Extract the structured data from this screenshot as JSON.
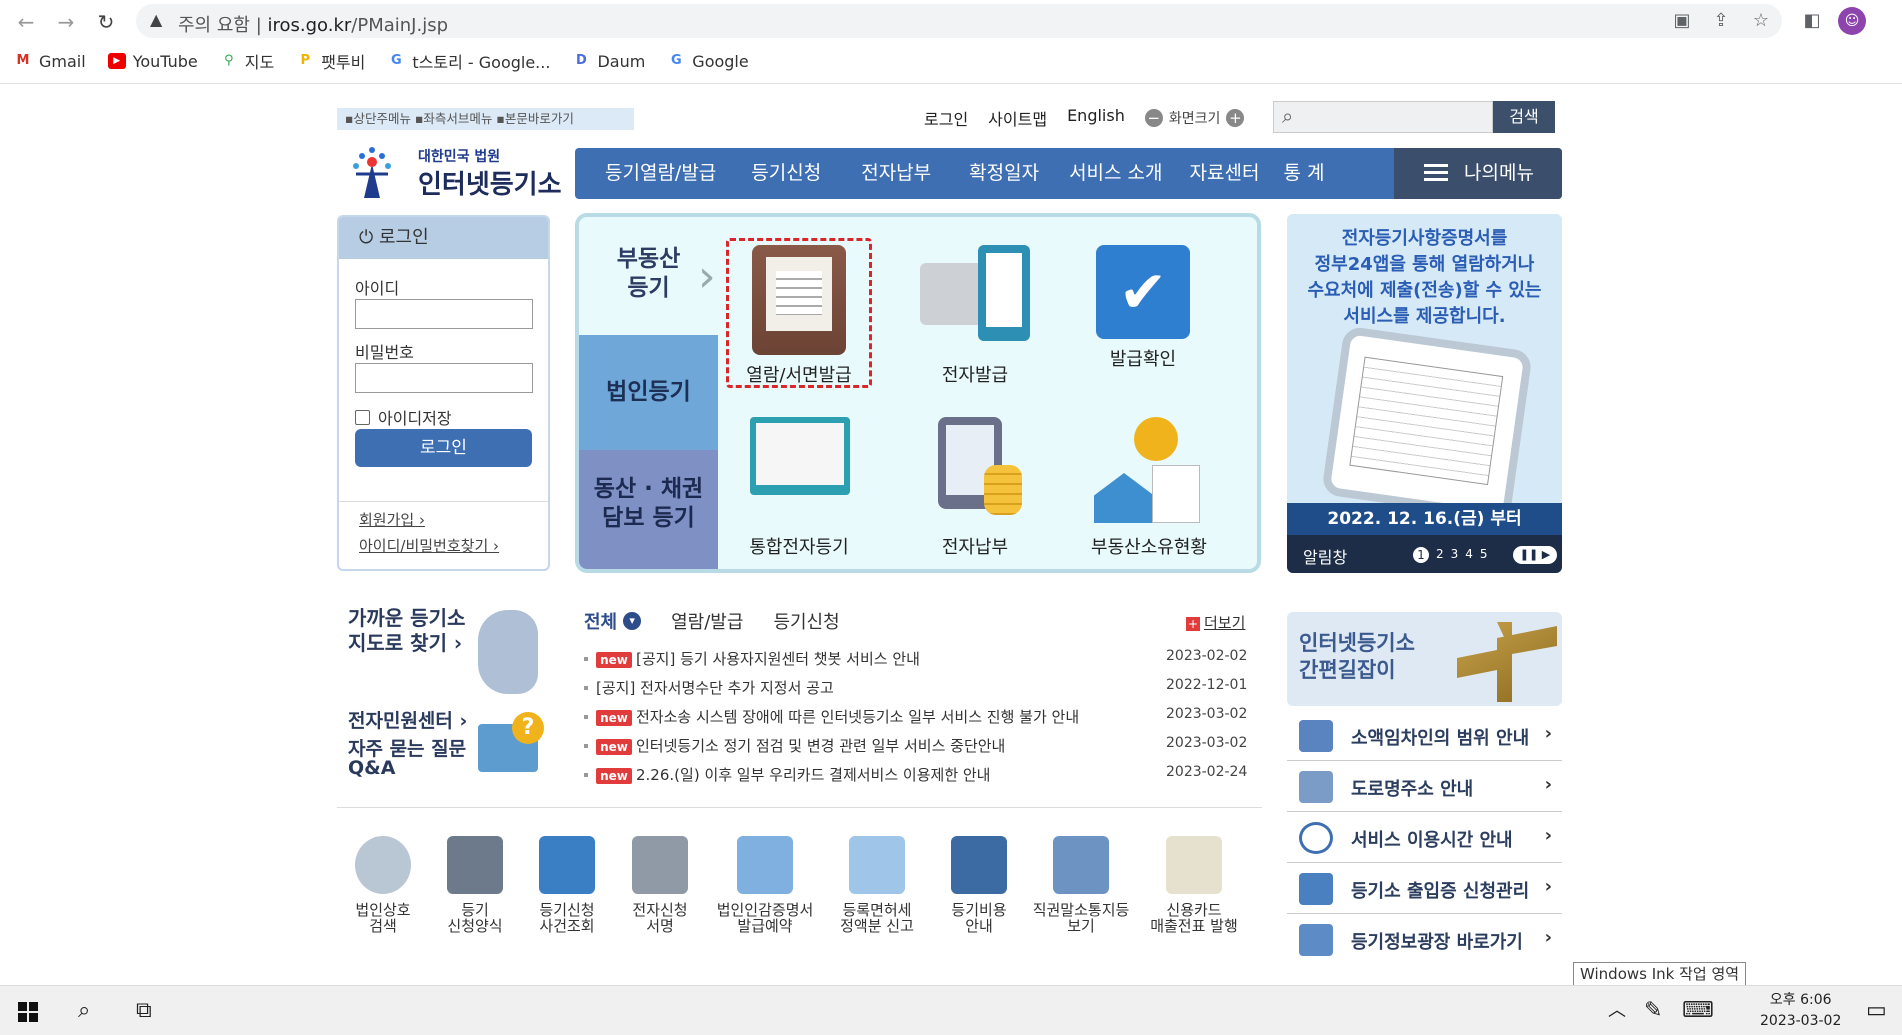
{
  "browser": {
    "warning": "주의 요함",
    "url_host": "iros.go.kr",
    "url_path": "/PMainJ.jsp",
    "bookmarks": [
      "Gmail",
      "YouTube",
      "지도",
      "팻투비",
      "t스토리 - Google...",
      "Daum",
      "Google"
    ]
  },
  "header": {
    "skip_links": "▪상단주메뉴 ▪좌측서브메뉴 ▪본문바로가기",
    "login": "로그인",
    "sitemap": "사이트맵",
    "english": "English",
    "zoom": "화면크기",
    "search_button": "검색",
    "logo_small": "대한민국 법원",
    "logo_big": "인터넷등기소"
  },
  "gnb": {
    "items": [
      "등기열람/발급",
      "등기신청",
      "전자납부",
      "확정일자",
      "서비스 소개",
      "자료센터",
      "통 계"
    ],
    "mymenu": "나의메뉴"
  },
  "login": {
    "title": "로그인",
    "id_label": "아이디",
    "pw_label": "비밀번호",
    "save_id": "아이디저장",
    "button": "로그인",
    "join": "회원가입 ›",
    "find": "아이디/비밀번호찾기 ›"
  },
  "services": {
    "tab1": "부동산\n등기",
    "tab2": "법인등기",
    "tab3": "동산 · 채권\n담보 등기",
    "items": [
      "열람/서면발급",
      "전자발급",
      "발급확인",
      "통합전자등기",
      "전자납부",
      "부동산소유현황"
    ]
  },
  "promo": {
    "text": "전자등기사항증명서를\n정부24앱을 통해 열람하거나\n수요처에 제출(전송)할 수 있는\n서비스를 제공합니다.",
    "date": "2022. 12. 16.(금) 부터",
    "label": "알림창",
    "pages": [
      "1",
      "2",
      "3",
      "4",
      "5"
    ]
  },
  "left": {
    "nearby": "가까운 등기소\n지도로 찾기 ›",
    "ecenter": "전자민원센터 ›",
    "faq": "자주 묻는 질문\nQ&A"
  },
  "notices": {
    "tabs": [
      "전체",
      "열람/발급",
      "등기신청"
    ],
    "more": "더보기",
    "new_badge": "new",
    "items": [
      {
        "new": true,
        "title": "[공지] 등기 사용자지원센터 챗봇 서비스 안내",
        "date": "2023-02-02"
      },
      {
        "new": false,
        "title": "[공지] 전자서명수단 추가 지정서 공고",
        "date": "2022-12-01"
      },
      {
        "new": true,
        "title": "전자소송 시스템 장애에 따른 인터넷등기소 일부 서비스 진행 불가 안내",
        "date": "2023-03-02"
      },
      {
        "new": true,
        "title": "인터넷등기소 정기 점검 및 변경 관련 일부 서비스 중단안내",
        "date": "2023-03-02"
      },
      {
        "new": true,
        "title": "2.26.(일) 이후 일부 우리카드 결제서비스 이용제한 안내",
        "date": "2023-02-24"
      }
    ]
  },
  "quick": [
    "법인상호\n검색",
    "등기\n신청양식",
    "등기신청\n사건조회",
    "전자신청\n서명",
    "법인인감증명서\n발급예약",
    "등록면허세\n정액분 신고",
    "등기비용\n안내",
    "직권말소통지등\n보기",
    "신용카드\n매출전표 발행"
  ],
  "easy_guide": "인터넷등기소\n간편길잡이",
  "quick_links": [
    "소액임차인의 범위 안내",
    "도로명주소 안내",
    "서비스 이용시간 안내",
    "등기소 출입증 신청관리",
    "등기정보광장 바로가기"
  ],
  "system": {
    "ink_tip": "Windows Ink 작업 영역",
    "time": "오후 6:06",
    "date": "2023-03-02"
  }
}
